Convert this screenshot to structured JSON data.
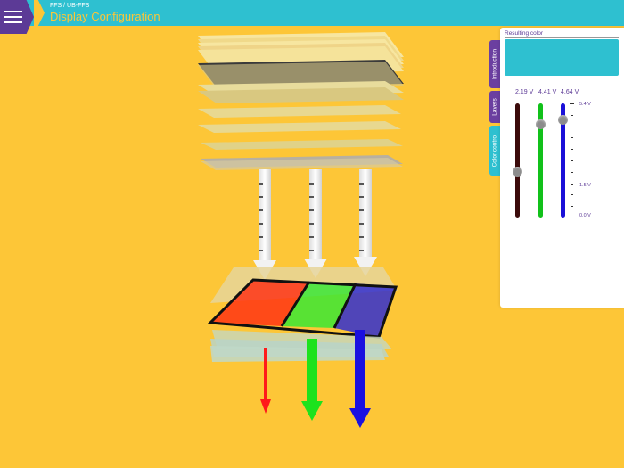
{
  "header": {
    "breadcrumb": "FFS / UB-FFS",
    "title": "Display Configuration",
    "menu_icon": "hamburger-menu-icon",
    "colors": {
      "bar": "#2ec0d0",
      "menu": "#5c3a96",
      "title": "#fdc637"
    }
  },
  "side_tabs": [
    {
      "label": "Introduction"
    },
    {
      "label": "Layers"
    },
    {
      "label": "Color control"
    }
  ],
  "panel": {
    "resulting_label": "Resulting color",
    "resulting_color": "#2ec0d0",
    "sliders": [
      {
        "channel": "red",
        "value_label": "2.19 V",
        "value": 2.19,
        "color": "#3b0a0a"
      },
      {
        "channel": "green",
        "value_label": "4.41 V",
        "value": 4.41,
        "color": "#11c11a"
      },
      {
        "channel": "blue",
        "value_label": "4.64 V",
        "value": 4.64,
        "color": "#1a10d8"
      }
    ],
    "scale": {
      "max_label": "5.4 V",
      "mid_label": "1.5 V",
      "min_label": "0.0 V",
      "min": 0.0,
      "max": 5.4,
      "mid": 1.5
    }
  },
  "scene": {
    "background": "#fdc637",
    "subpixels": [
      {
        "name": "red",
        "color": "#ff2a10"
      },
      {
        "name": "green",
        "color": "#2ee833"
      },
      {
        "name": "blue",
        "color": "#2424d8"
      }
    ]
  }
}
